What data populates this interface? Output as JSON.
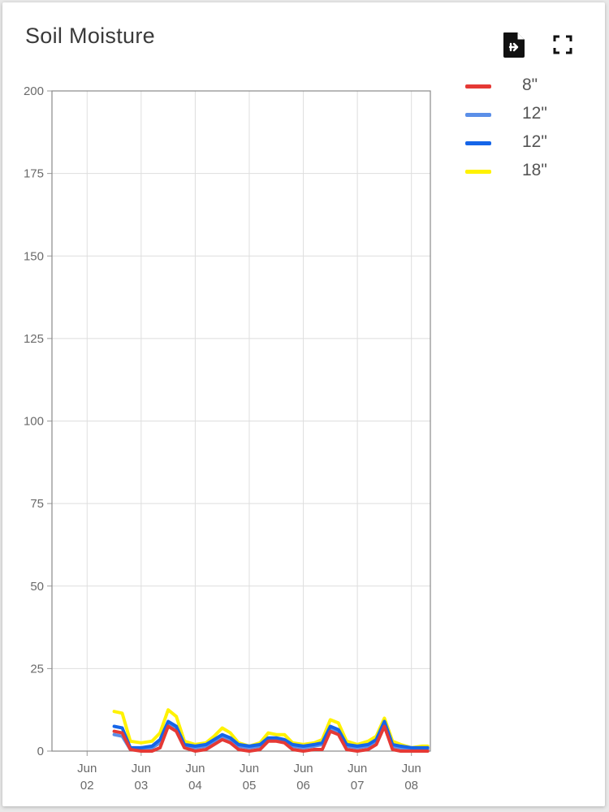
{
  "card": {
    "title": "Soil Moisture",
    "export_icon": "file-export-icon",
    "fullscreen_icon": "fullscreen-icon"
  },
  "chart_data": {
    "type": "line",
    "title": "Soil Moisture",
    "xlabel": "",
    "ylabel": "",
    "ylim": [
      0,
      200
    ],
    "y_ticks": [
      0,
      25,
      50,
      75,
      100,
      125,
      150,
      175,
      200
    ],
    "x_ticks": [
      {
        "line1": "Jun",
        "line2": "02",
        "x": 2
      },
      {
        "line1": "Jun",
        "line2": "03",
        "x": 3
      },
      {
        "line1": "Jun",
        "line2": "04",
        "x": 4
      },
      {
        "line1": "Jun",
        "line2": "05",
        "x": 5
      },
      {
        "line1": "Jun",
        "line2": "06",
        "x": 6
      },
      {
        "line1": "Jun",
        "line2": "07",
        "x": 7
      },
      {
        "line1": "Jun",
        "line2": "08",
        "x": 8
      }
    ],
    "xlim": [
      1.35,
      8.35
    ],
    "grid": true,
    "legend_position": "right",
    "x": [
      2.5,
      2.65,
      2.8,
      3.0,
      3.2,
      3.35,
      3.5,
      3.65,
      3.8,
      4.0,
      4.2,
      4.35,
      4.5,
      4.65,
      4.8,
      5.0,
      5.2,
      5.35,
      5.5,
      5.65,
      5.8,
      6.0,
      6.2,
      6.35,
      6.5,
      6.65,
      6.8,
      7.0,
      7.2,
      7.35,
      7.5,
      7.65,
      7.8,
      8.0,
      8.2,
      8.3
    ],
    "series": [
      {
        "name": "8\"",
        "color": "#e53935",
        "values": [
          6,
          5.5,
          0.5,
          0,
          0,
          1,
          7.5,
          6,
          1,
          0,
          0.5,
          2,
          3.5,
          2.5,
          0.5,
          0,
          0.5,
          3,
          3,
          2.5,
          0.5,
          0,
          0.5,
          0.5,
          6,
          5,
          0.5,
          0,
          0.5,
          2,
          7.5,
          0.5,
          0,
          0,
          0,
          0
        ]
      },
      {
        "name": "12\"",
        "color": "#5b8fe8",
        "values": [
          5,
          4.5,
          0.5,
          0.5,
          1,
          2.5,
          8,
          6.5,
          1.5,
          1,
          1.5,
          3,
          4.5,
          3.5,
          1.5,
          1,
          1.5,
          3.5,
          3.5,
          3,
          1.5,
          1,
          1.5,
          2,
          6.5,
          5.5,
          1.5,
          1,
          1.5,
          3,
          8,
          1.5,
          1,
          0.5,
          0.5,
          0.5
        ]
      },
      {
        "name": "12\"",
        "color": "#1565e8",
        "values": [
          7.5,
          7,
          1,
          1,
          1.5,
          3.5,
          9,
          7.5,
          2,
          1.5,
          2,
          3.5,
          5,
          4,
          2,
          1.5,
          2,
          4,
          4,
          3.5,
          2,
          1.5,
          2,
          2.5,
          7.5,
          6.5,
          2,
          1.5,
          2,
          3.5,
          9,
          2,
          1.5,
          1,
          1,
          1
        ]
      },
      {
        "name": "18\"",
        "color": "#fff200",
        "values": [
          12,
          11.5,
          3,
          2.5,
          3,
          5.5,
          12.5,
          10.5,
          3,
          2,
          2.5,
          4.5,
          7,
          5.5,
          2.5,
          1.5,
          2.5,
          5.5,
          5,
          5,
          2.5,
          2,
          2.5,
          3.5,
          9.5,
          8.5,
          3,
          2,
          3,
          4.5,
          10,
          3,
          2,
          1,
          1.5,
          1.5
        ]
      }
    ]
  }
}
